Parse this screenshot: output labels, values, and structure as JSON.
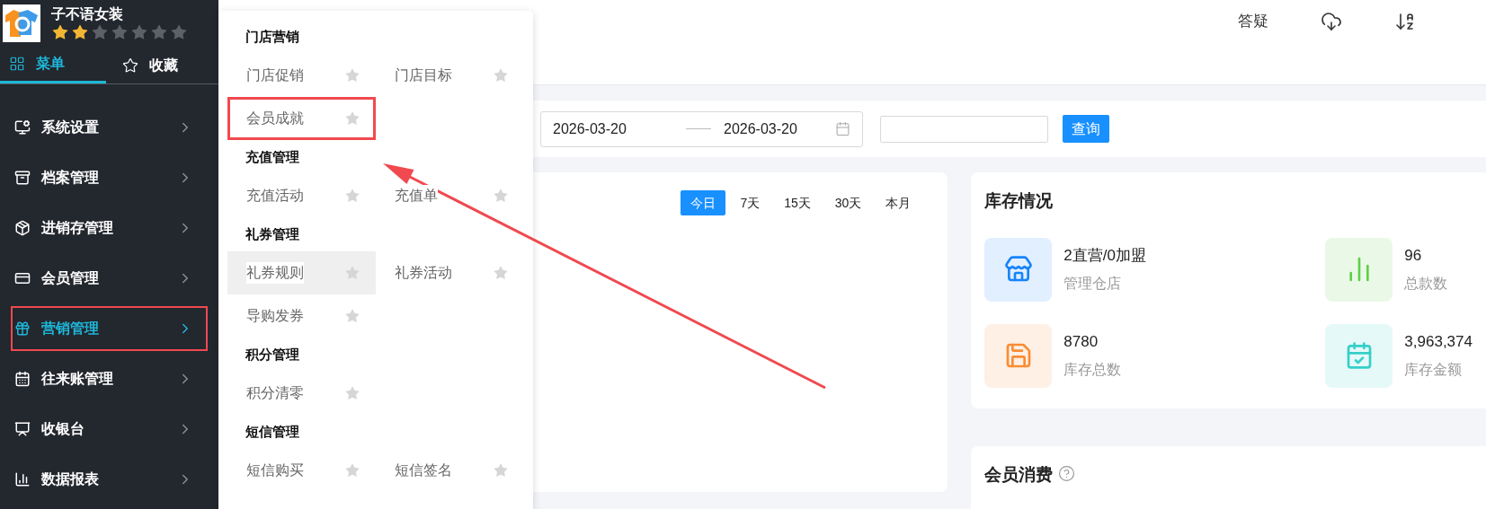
{
  "app": {
    "name": "子不语女装",
    "stars": 2
  },
  "sidebar_tabs": [
    {
      "label": "菜单",
      "selected": true
    },
    {
      "label": "收藏",
      "selected": false
    }
  ],
  "sidebar": {
    "items": [
      {
        "label": "系统设置",
        "selected": false,
        "highlighted": false
      },
      {
        "label": "档案管理",
        "selected": false,
        "highlighted": false
      },
      {
        "label": "进销存管理",
        "selected": false,
        "highlighted": false
      },
      {
        "label": "会员管理",
        "selected": false,
        "highlighted": false
      },
      {
        "label": "营销管理",
        "selected": true,
        "highlighted": true
      },
      {
        "label": "往来账管理",
        "selected": false,
        "highlighted": false
      },
      {
        "label": "收银台",
        "selected": false,
        "highlighted": false
      },
      {
        "label": "数据报表",
        "selected": false,
        "highlighted": false
      }
    ]
  },
  "header": {
    "links": [
      {
        "kind": "text",
        "label": "答疑"
      },
      {
        "kind": "cloud"
      },
      {
        "kind": "sort"
      }
    ]
  },
  "menu": {
    "groups": [
      {
        "title": "门店营销",
        "items": [
          {
            "label": "门店促销",
            "selected": false,
            "highlighted": false
          },
          {
            "label": "门店目标",
            "selected": false,
            "highlighted": false
          },
          {
            "label": "会员成就",
            "selected": false,
            "highlighted": true
          }
        ]
      },
      {
        "title": "充值管理",
        "items": [
          {
            "label": "充值活动",
            "selected": false,
            "highlighted": false
          },
          {
            "label": "充值单",
            "selected": false,
            "highlighted": false
          }
        ]
      },
      {
        "title": "礼券管理",
        "items": [
          {
            "label": "礼券规则",
            "selected": true,
            "highlighted": false
          },
          {
            "label": "礼券活动",
            "selected": false,
            "highlighted": false
          },
          {
            "label": "导购发券",
            "selected": false,
            "highlighted": false
          }
        ]
      },
      {
        "title": "积分管理",
        "items": [
          {
            "label": "积分清零",
            "selected": false,
            "highlighted": false
          }
        ]
      },
      {
        "title": "短信管理",
        "items": [
          {
            "label": "短信购买",
            "selected": false,
            "highlighted": false
          },
          {
            "label": "短信签名",
            "selected": false,
            "highlighted": false
          }
        ]
      }
    ]
  },
  "filters": {
    "date_from": "2026-03-20",
    "date_to": "2026-03-20",
    "query_button": "查询"
  },
  "sales_card": {
    "ranges": [
      {
        "label": "今日",
        "selected": true
      },
      {
        "label": "7天",
        "selected": false
      },
      {
        "label": "15天",
        "selected": false
      },
      {
        "label": "30天",
        "selected": false
      },
      {
        "label": "本月",
        "selected": false
      }
    ]
  },
  "inventory": {
    "title": "库存情况",
    "stats": [
      {
        "value": "2直营/0加盟",
        "label": "管理仓店",
        "color": "#1684fc"
      },
      {
        "value": "96",
        "label": "总款数",
        "color": "#5fcf48"
      },
      {
        "value": "8780",
        "label": "库存总数",
        "color": "#fa8c35"
      },
      {
        "value": "3,963,374",
        "label": "库存金额",
        "color": "#36cfc9"
      }
    ]
  },
  "member_card": {
    "title": "会员消费"
  }
}
